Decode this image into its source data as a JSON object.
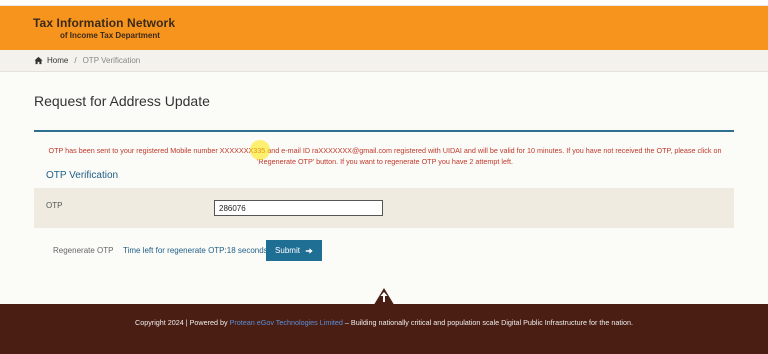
{
  "header": {
    "title": "Tax Information Network",
    "subtitle": "of Income Tax Department",
    "color": "#f7941d"
  },
  "breadcrumb": {
    "home_icon": "home-icon",
    "home": "Home",
    "separator": "/",
    "current": "OTP Verification"
  },
  "page": {
    "title": "Request for Address Update",
    "otp_message": "OTP has been sent to your registered Mobile number XXXXXXX335 and e-mail ID raXXXXXXX@gmail.com registered with UIDAI and will be valid for 10 minutes. If you have not received the OTP, please click on 'Regenerate OTP' button. If you want to regenerate OTP you have 2 attempt left.",
    "section_title": "OTP Verification"
  },
  "form": {
    "otp_label": "OTP",
    "otp_value": "286076",
    "regenerate_label": "Regenerate OTP",
    "timer_text": "Time left for regenerate OTP:18 seconds",
    "submit_label": "Submit",
    "submit_icon": "arrow-right-icon"
  },
  "footer": {
    "prefix": "Copyright 2024 | Powered by ",
    "link": "Protean eGov Technologies Limited",
    "suffix": " – Building nationally critical and population scale Digital Public Infrastructure for the nation.",
    "scroll_icon": "arrow-up-icon",
    "color": "#4b1e14"
  }
}
